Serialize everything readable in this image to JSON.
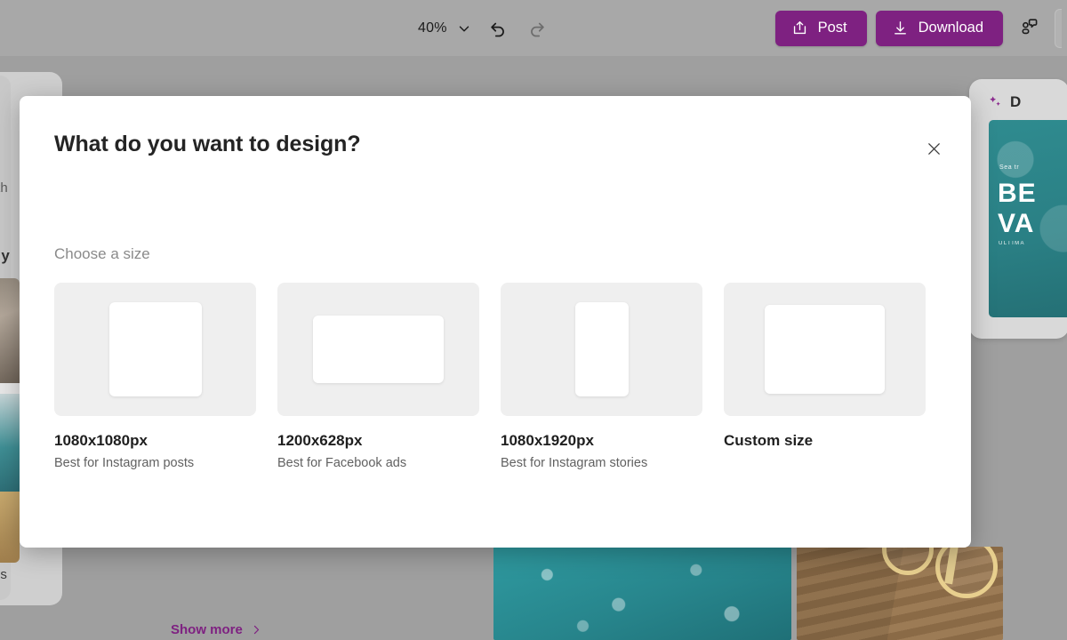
{
  "toolbar": {
    "zoom_level": "40%",
    "zoom_caret_icon": "chevron-down-icon",
    "undo_icon": "undo-icon",
    "redo_icon": "redo-icon",
    "post_label": "Post",
    "post_icon": "share-icon",
    "download_label": "Download",
    "download_icon": "download-icon",
    "collaborate_icon": "person-comment-icon",
    "accent_color": "#7e2181",
    "background_color": "#a8a8a8"
  },
  "workspace": {
    "background_color": "#9f9f9f",
    "left_panel": {
      "fragment_top": "/th",
      "fragment_middle": "r y",
      "fragment_bottom": "os",
      "show_more_label": "Show more",
      "show_more_icon": "chevron-right-icon",
      "show_more_color": "#7e2181"
    },
    "right_panel": {
      "sparkle_icon": "sparkle-icon",
      "title": "D",
      "thumbnail": {
        "eyebrow": "Sea tr",
        "line1": "BE",
        "line2": "VA",
        "sub": "ULTIMA",
        "color": "#2a7f84"
      }
    },
    "canvas_photos": [
      {
        "name": "pool-water-photo",
        "color": "#27858c"
      },
      {
        "name": "bicycle-dock-photo",
        "color": "#8a6a46"
      }
    ]
  },
  "modal": {
    "title": "What do you want to design?",
    "close_icon": "close-icon",
    "section_label": "Choose a size",
    "sizes": [
      {
        "name": "1080x1080px",
        "description": "Best for Instagram posts",
        "shape": "square"
      },
      {
        "name": "1200x628px",
        "description": "Best for Facebook ads",
        "shape": "landscape"
      },
      {
        "name": "1080x1920px",
        "description": "Best for Instagram stories",
        "shape": "portrait"
      },
      {
        "name": "Custom size",
        "description": "",
        "shape": "custom"
      }
    ]
  }
}
